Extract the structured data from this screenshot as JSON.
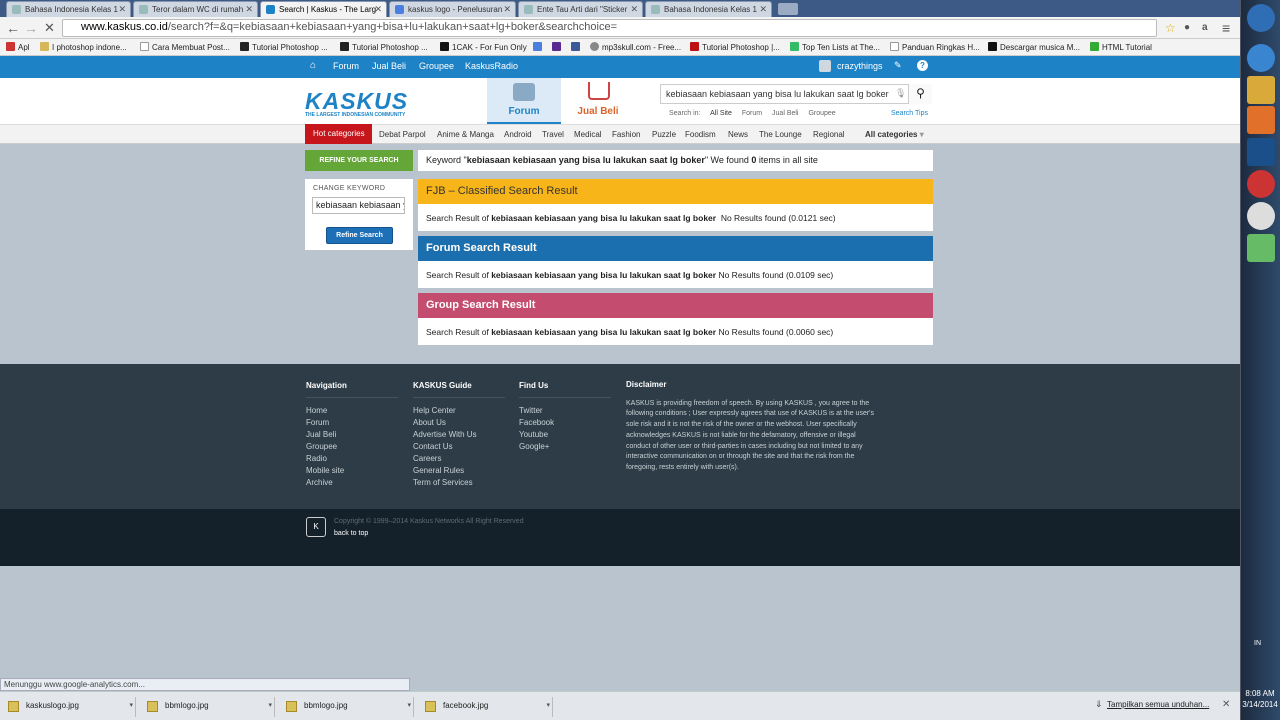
{
  "browser": {
    "tabs": [
      {
        "title": "Bahasa Indonesia Kelas 1"
      },
      {
        "title": "Teror dalam WC di rumah"
      },
      {
        "title": "Search | Kaskus - The Larg",
        "active": true
      },
      {
        "title": "kaskus logo - Penelusuran"
      },
      {
        "title": "Ente Tau Arti dari \"Sticker"
      },
      {
        "title": "Bahasa Indonesia Kelas 1"
      }
    ],
    "url_domain": "www.kaskus.co.id",
    "url_path": "/search?f=&q=kebiasaan+kebiasaan+yang+bisa+lu+lakukan+saat+lg+boker&searchchoice=",
    "bookmarks": [
      "Apl",
      "I photoshop indone...",
      "Cara Membuat Post...",
      "Tutorial Photoshop ...",
      "Tutorial Photoshop ...",
      "1CAK - For Fun Only",
      "mp3skull.com - Free...",
      "Tutorial Photoshop |...",
      "Top Ten Lists at The...",
      "Panduan Ringkas H...",
      "Descargar musica M...",
      "HTML Tutorial"
    ]
  },
  "topnav": {
    "items": [
      "Forum",
      "Jual Beli",
      "Groupee",
      "KaskusRadio"
    ],
    "username": "crazythings"
  },
  "header": {
    "logo_text": "KASKUS",
    "logo_tagline": "THE LARGEST INDONESIAN COMMUNITY",
    "forum_tab": "Forum",
    "jualbeli_tab": "Jual Beli",
    "search_value": "kebiasaan kebiasaan yang bisa lu lakukan saat lg boker",
    "search_in_label": "Search in:",
    "search_in_options": [
      "All Site",
      "Forum",
      "Jual Beli",
      "Groupee"
    ],
    "search_tips": "Search Tips"
  },
  "categories": {
    "hot": "Hot categories",
    "items": [
      "Debat Parpol",
      "Anime & Manga",
      "Android",
      "Travel",
      "Medical",
      "Fashion",
      "Puzzle",
      "Foodism",
      "News",
      "The Lounge",
      "Regional"
    ],
    "all": "All categories"
  },
  "refine": {
    "header": "REFINE YOUR SEARCH",
    "change_keyword": "CHANGE KEYWORD",
    "keyword_value": "kebiasaan kebiasaan yang",
    "button": "Refine Search"
  },
  "keyword_summary": {
    "prefix": "Keyword \"",
    "keyword": "kebiasaan kebiasaan yang bisa lu lakukan saat lg boker",
    "mid": "\" We found ",
    "count": "0",
    "suffix": " items in all site"
  },
  "sections": [
    {
      "title": "FJB – Classified Search Result",
      "prefix": "Search Result of ",
      "keyword": "kebiasaan kebiasaan yang bisa lu lakukan saat lg boker",
      "result": "  No Results found (0.0121 sec)"
    },
    {
      "title": "Forum Search Result",
      "prefix": "Search Result of ",
      "keyword": "kebiasaan kebiasaan yang bisa lu lakukan saat lg boker",
      "result": " No Results found (0.0109 sec)"
    },
    {
      "title": "Group Search Result",
      "prefix": "Search Result of ",
      "keyword": "kebiasaan kebiasaan yang bisa lu lakukan saat lg boker",
      "result": " No Results found (0.0060 sec)"
    }
  ],
  "footer": {
    "navigation": {
      "title": "Navigation",
      "links": [
        "Home",
        "Forum",
        "Jual Beli",
        "Groupee",
        "Radio",
        "Mobile site",
        "Archive"
      ]
    },
    "guide": {
      "title": "KASKUS Guide",
      "links": [
        "Help Center",
        "About Us",
        "Advertise With Us",
        "Contact Us",
        "Careers",
        "General Rules",
        "Term of Services"
      ]
    },
    "findus": {
      "title": "Find Us",
      "links": [
        "Twitter",
        "Facebook",
        "Youtube",
        "Google+"
      ]
    },
    "disclaimer": {
      "title": "Disclaimer",
      "text": "KASKUS is providing freedom of speech. By using KASKUS , you agree to the following conditions ; User expressly agrees that use of KASKUS is at the user's sole risk and it is not the risk of the owner or the webhost. User specifically acknowledges KASKUS is not liable for the defamatory, offensive or illegal conduct of other user or third-parties in cases including but not limited to any interactive communication on or through the site and that the risk from the foregoing, rests entirely with user(s)."
    },
    "icon_text": "K",
    "copyright": "Copyright © 1999–2014 Kaskus Networks All Right Reserved",
    "back_to_top": "back to top"
  },
  "statusbar": "Menunggu www.google-analytics.com...",
  "downloads": {
    "items": [
      "kaskuslogo.jpg",
      "bbmlogo.jpg",
      "bbmlogo.jpg",
      "facebook.jpg"
    ],
    "show_all": "Tampilkan semua unduhan..."
  },
  "system": {
    "lang": "IN",
    "time": "8:08 AM",
    "date": "3/14/2014"
  }
}
